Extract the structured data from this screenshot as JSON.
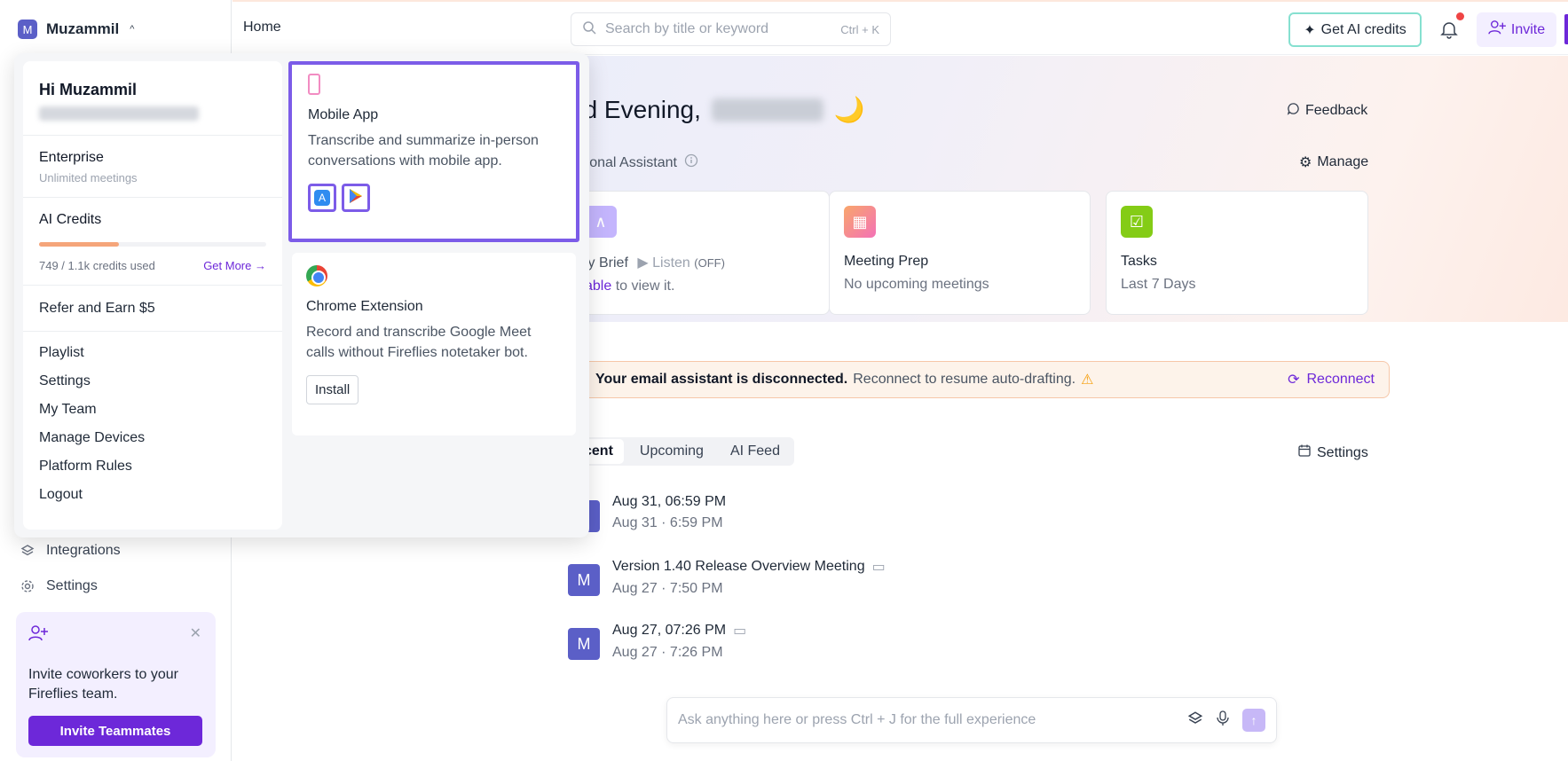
{
  "sidebar": {
    "user_initial": "M",
    "user_name": "Muzammil",
    "links": [
      {
        "label": "Integrations",
        "icon": "layers-icon"
      },
      {
        "label": "Settings",
        "icon": "gear-icon"
      }
    ],
    "invite_card": {
      "text": "Invite coworkers to your Fireflies team.",
      "button": "Invite Teammates"
    }
  },
  "header": {
    "breadcrumb": "Home",
    "search_placeholder": "Search by title or keyword",
    "search_shortcut": "Ctrl + K",
    "get_credits": "Get AI credits",
    "invite": "Invite"
  },
  "main": {
    "greeting": "od Evening,",
    "greeting_emoji": "🌙",
    "feedback": "Feedback",
    "assistant_label": "ersonal Assistant",
    "manage": "Manage",
    "cards": [
      {
        "title": "ly Brief",
        "extra": "Listen",
        "extra_state": "(OFF)",
        "sub_link": "able",
        "sub": " to view it."
      },
      {
        "title": "Meeting Prep",
        "sub": "No upcoming meetings"
      },
      {
        "title": "Tasks",
        "sub": "Last 7 Days"
      }
    ],
    "alert": {
      "bold": "Your email assistant is disconnected.",
      "text": "Reconnect to resume auto-drafting.",
      "action": "Reconnect"
    },
    "tabs": [
      "cent",
      "Upcoming",
      "AI Feed"
    ],
    "tab_settings": "Settings",
    "meetings": [
      {
        "initial": "",
        "title": "Aug 31, 06:59 PM",
        "sub": "Aug 31 · 6:59 PM"
      },
      {
        "initial": "M",
        "title": "Version 1.40 Release Overview Meeting",
        "sub": "Aug 27 · 7:50 PM"
      },
      {
        "initial": "M",
        "title": "Aug 27, 07:26 PM",
        "sub": "Aug 27 · 7:26 PM"
      }
    ],
    "ask_placeholder": "Ask anything here or press Ctrl + J for the full experience"
  },
  "dropdown": {
    "greeting": "Hi Muzammil",
    "plan": "Enterprise",
    "plan_sub": "Unlimited meetings",
    "credits_title": "AI Credits",
    "credits_used": 749,
    "credits_total_label": "1.1k",
    "credits_text": "749 / 1.1k credits used",
    "credits_fraction": 0.35,
    "get_more": "Get More",
    "refer": "Refer and Earn $5",
    "menu": [
      "Playlist",
      "Settings",
      "My Team",
      "Manage Devices",
      "Platform Rules",
      "Logout"
    ],
    "mobile": {
      "title": "Mobile App",
      "desc": "Transcribe and summarize in-person conversations with mobile app."
    },
    "chrome": {
      "title": "Chrome Extension",
      "desc": "Record and transcribe Google Meet calls without Fireflies notetaker bot.",
      "button": "Install"
    }
  },
  "colors": {
    "accent": "#6d28d9",
    "highlight": "#7c5ce8",
    "avatar": "#5b5fc7"
  }
}
